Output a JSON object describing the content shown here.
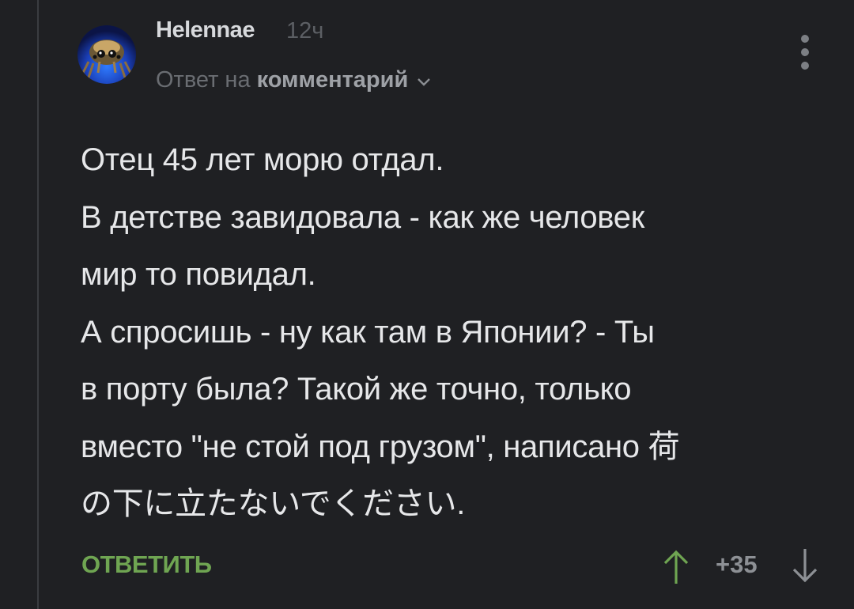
{
  "comment": {
    "author": "Helennae",
    "time": "12ч",
    "reply_prefix": "Ответ на",
    "reply_link": "комментарий",
    "body_lines": [
      "Отец 45 лет морю отдал.",
      "В детстве завидовала - как же человек",
      "мир то повидал.",
      "А спросишь - ну как там в Японии? - Ты",
      "в порту была? Такой же точно, только",
      "вместо \"не стой под грузом\", написано 荷",
      "の下に立たないでください."
    ]
  },
  "actions": {
    "reply_label": "ОТВЕТИТЬ",
    "score": "+35"
  },
  "icons": {
    "avatar": "spider-avatar",
    "chevron": "chevron-down-icon",
    "menu": "more-vertical-icon",
    "up": "arrow-up-icon",
    "down": "arrow-down-icon"
  },
  "colors": {
    "background": "#1f2023",
    "accent_green": "#6fa552",
    "text": "#e6e7e9"
  }
}
